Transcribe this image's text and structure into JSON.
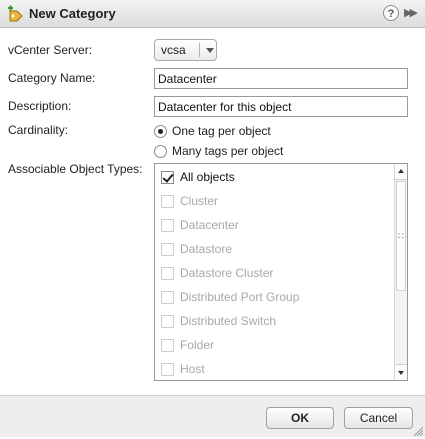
{
  "dialog": {
    "title": "New Category",
    "help_label": "?",
    "expand_label": "▶▶"
  },
  "form": {
    "vcenter_label": "vCenter Server:",
    "vcenter_value": "vcsa",
    "category_name_label": "Category Name:",
    "category_name_value": "Datacenter",
    "description_label": "Description:",
    "description_value": "Datacenter for this object",
    "cardinality_label": "Cardinality:",
    "cardinality_options": [
      {
        "label": "One tag per object",
        "selected": true
      },
      {
        "label": "Many tags per object",
        "selected": false
      }
    ],
    "object_types_label": "Associable Object Types:",
    "object_types": [
      {
        "label": "All objects",
        "checked": true,
        "enabled": true
      },
      {
        "label": "Cluster",
        "checked": false,
        "enabled": false
      },
      {
        "label": "Datacenter",
        "checked": false,
        "enabled": false
      },
      {
        "label": "Datastore",
        "checked": false,
        "enabled": false
      },
      {
        "label": "Datastore Cluster",
        "checked": false,
        "enabled": false
      },
      {
        "label": "Distributed Port Group",
        "checked": false,
        "enabled": false
      },
      {
        "label": "Distributed Switch",
        "checked": false,
        "enabled": false
      },
      {
        "label": "Folder",
        "checked": false,
        "enabled": false
      },
      {
        "label": "Host",
        "checked": false,
        "enabled": false
      }
    ]
  },
  "footer": {
    "ok_label": "OK",
    "cancel_label": "Cancel"
  },
  "icons": {
    "title_icon": "new-tag-category-icon",
    "grip_glyph": "∷"
  }
}
